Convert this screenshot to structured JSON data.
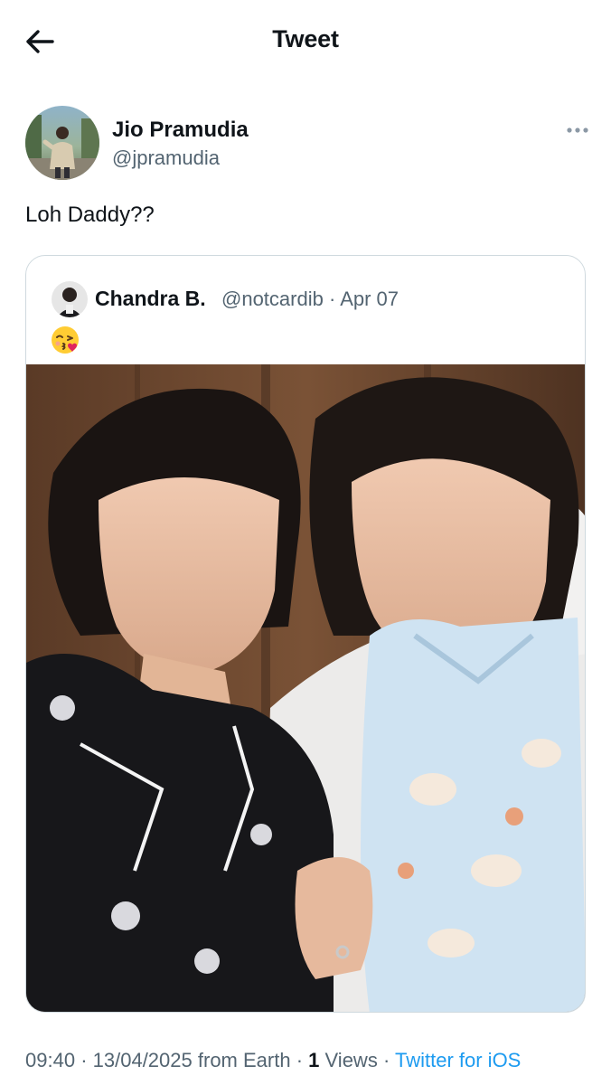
{
  "header": {
    "title": "Tweet",
    "back_icon": "arrow-left-icon"
  },
  "author": {
    "name": "Jio Pramudia",
    "handle": "@jpramudia",
    "avatar_icon": "avatar-photo",
    "more_icon": "more-horizontal-icon"
  },
  "tweet": {
    "text": "Loh Daddy??"
  },
  "quoted": {
    "name": "Chandra B.",
    "handle": "@notcardib",
    "separator": "·",
    "date": "Apr 07",
    "emoji": "face-blowing-a-kiss",
    "media": "photo"
  },
  "footer": {
    "time": "09:40",
    "sep1": "·",
    "date": "13/04/2025",
    "location": "from Earth",
    "sep2": "·",
    "views_count": "1",
    "views_label": "Views",
    "sep3": "·",
    "source": "Twitter for iOS"
  },
  "colors": {
    "text_primary": "#0f1419",
    "text_secondary": "#536471",
    "link": "#1d9bf0",
    "border": "#cfd9de"
  }
}
